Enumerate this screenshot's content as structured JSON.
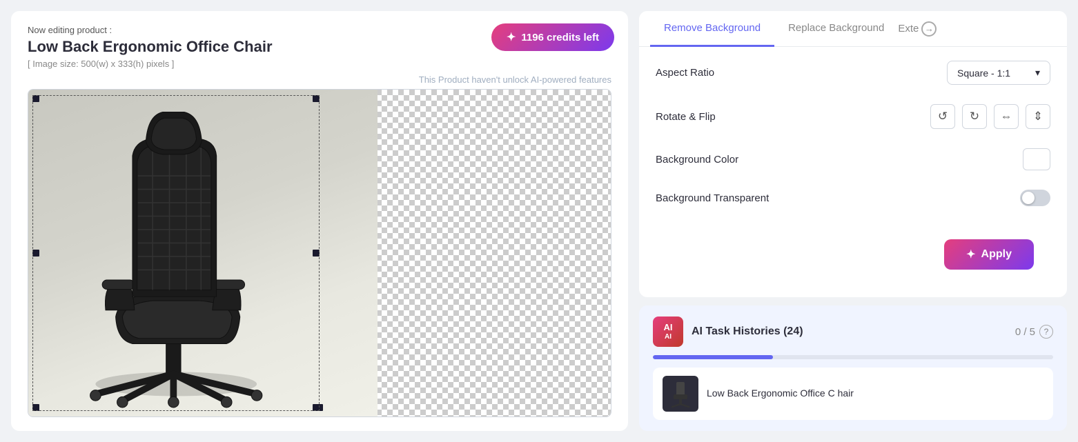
{
  "left": {
    "editing_prefix": "Now editing product :",
    "product_title": "Low Back Ergonomic Office Chair",
    "image_size": "[ Image size: 500(w) x 333(h) pixels ]",
    "ai_warning": "This Product haven't unlock AI-powered features"
  },
  "credits": {
    "label": "1196 credits left"
  },
  "tabs": {
    "remove_bg": "Remove Background",
    "replace_bg": "Replace Background",
    "extend": "Exte"
  },
  "settings": {
    "aspect_ratio_label": "Aspect Ratio",
    "aspect_ratio_value": "Square - 1:1",
    "rotate_flip_label": "Rotate & Flip",
    "bg_color_label": "Background Color",
    "bg_transparent_label": "Background Transparent"
  },
  "apply_btn": "Apply",
  "history": {
    "title": "AI Task Histories (24)",
    "count": "0 / 5",
    "item_title": "Low Back Ergonomic Office Chair",
    "item_title_short": "Low Back Ergonomic Office C hair"
  },
  "icons": {
    "star": "✦",
    "rotate_ccw": "↺",
    "rotate_cw": "↻",
    "flip_h": "⇔",
    "flip_v": "⇕",
    "chevron_down": "▾",
    "arrow_right": "→",
    "wand": "✦",
    "question": "?"
  }
}
